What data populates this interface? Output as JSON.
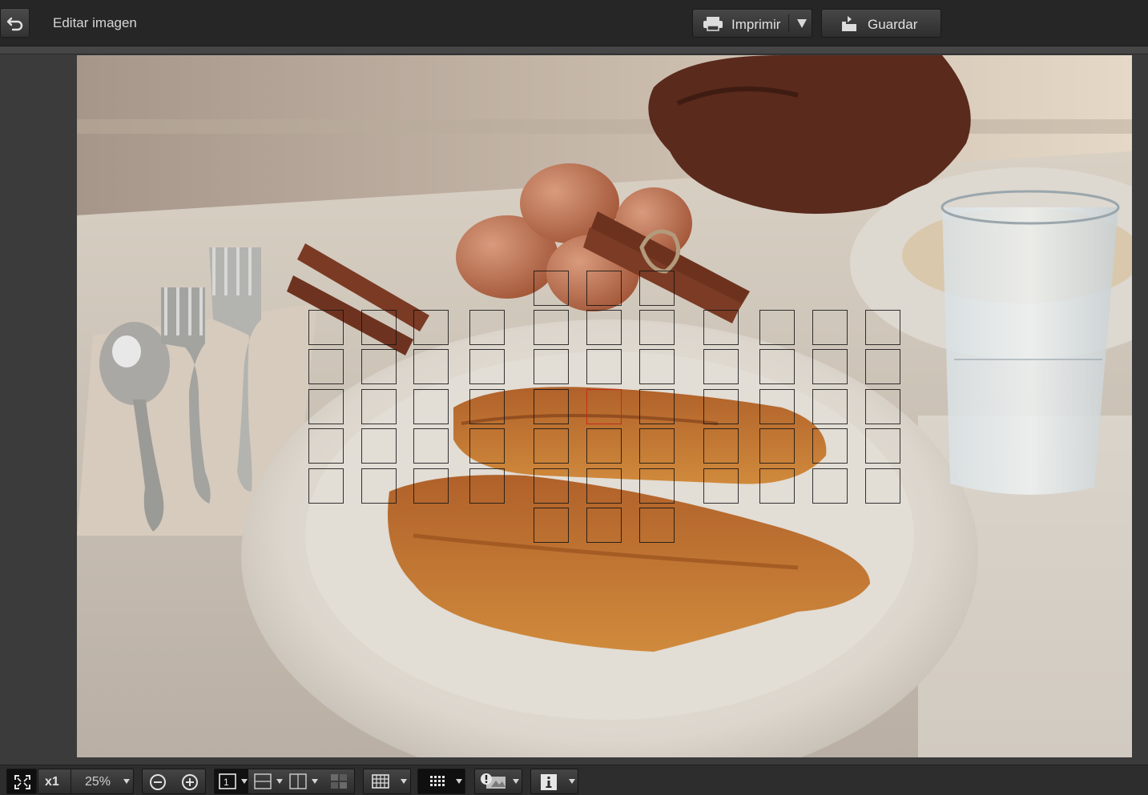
{
  "header": {
    "back_icon": "undo-arrow-icon",
    "title": "Editar imagen",
    "print_label": "Imprimir",
    "print_icon": "printer-icon",
    "save_label": "Guardar",
    "save_icon": "save-icon"
  },
  "toolbar": {
    "fit_icon": "fit-to-screen-icon",
    "zoom_1x_label": "x1",
    "zoom_value": "25%",
    "zoom_out_icon": "zoom-out-icon",
    "zoom_in_icon": "zoom-in-icon",
    "view_single_icon": "single-view-icon",
    "view_compare_icon": "compare-view-icon",
    "view_split_icon": "split-view-icon",
    "view_multi_icon": "multi-view-icon",
    "grid_icon": "grid-icon",
    "af_points_icon": "af-points-icon",
    "highlight_warning_icon": "highlight-warning-icon",
    "info_icon": "info-icon"
  },
  "colors": {
    "af_point": "#1a1a1a",
    "af_point_active": "#c42a1e",
    "topbar": "#262626",
    "background": "#3b3b3b"
  },
  "af_points": {
    "rows": 7,
    "active": {
      "row": 3,
      "col": 5
    }
  }
}
